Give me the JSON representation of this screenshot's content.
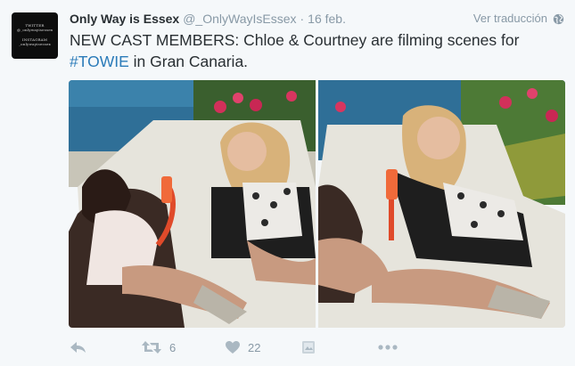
{
  "tweet": {
    "display_name": "Only Way is Essex",
    "screen_name": "@_OnlyWayIsEssex",
    "separator": "·",
    "timestamp": "16 feb.",
    "translate_label": "Ver traducción",
    "text_before": "NEW CAST MEMBERS: Chloe & Courtney are filming scenes for ",
    "hashtag": "#TOWIE",
    "text_after": " in Gran Canaria."
  },
  "avatar": {
    "line1": "TWITTER",
    "line2": "@_onlywayisessex",
    "line3": "INSTAGRAM",
    "line4": "_onlywayisessex"
  },
  "actions": {
    "reply_icon": "reply-icon",
    "retweet_icon": "retweet-icon",
    "retweet_count": "6",
    "like_icon": "heart-icon",
    "like_count": "22",
    "pic_icon": "photo-icon",
    "more_icon": "more-icon"
  },
  "colors": {
    "background": "#f5f8fa",
    "text": "#292f33",
    "muted": "#8899a6",
    "hashtag": "#2b7bb9"
  }
}
